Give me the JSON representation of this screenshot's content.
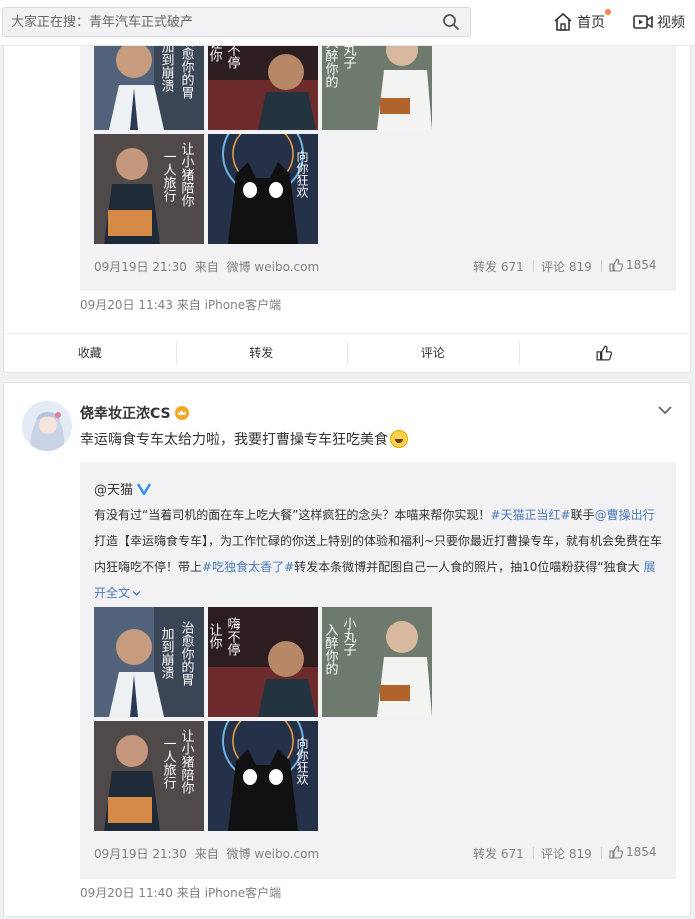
{
  "header": {
    "search_placeholder": "大家正在搜：青年汽车正式破产",
    "nav": [
      {
        "label": "首页",
        "icon": "home-icon"
      },
      {
        "label": "视频",
        "icon": "video-icon"
      }
    ]
  },
  "post1": {
    "repost_meta": {
      "time": "09月19日 21:30",
      "from": "来自",
      "source": "微博 weibo.com"
    },
    "stats": {
      "forward": "转发 671",
      "comment": "评论 819",
      "like": "1854"
    },
    "post_meta": {
      "time": "09月20日 11:43",
      "from": "来自",
      "source": "iPhone客户端"
    },
    "actions": [
      "收藏",
      "转发",
      "评论"
    ]
  },
  "post2": {
    "username": "侥幸妆正浓CS",
    "text": "幸运嗨食专车太给力啦，我要打曹操专车狂吃美食",
    "repost": {
      "author": "@天猫",
      "text_parts": {
        "p1": "有没有过“当着司机的面在车上吃大餐”这样疯狂的念头？本喵来帮你实现！",
        "tag1": "#天猫正当红#",
        "p2": "联手",
        "mention": "@曹操出行",
        "p3": " 打造【幸运嗨食专车】，为工作忙碌的你送上特别的体验和福利~只要你最近打曹操专车，就有机会免费在车内狂嗨吃不停！带上",
        "tag2": "#吃独食太香了#",
        "p4": "转发本条微博并配图自己一人食的照片，抽10位喵粉获得“独食大",
        "expand": "展开全文"
      },
      "meta": {
        "time": "09月19日 21:30",
        "from": "来自",
        "source": "微博 weibo.com"
      },
      "stats": {
        "forward": "转发 671",
        "comment": "评论 819",
        "like": "1854"
      }
    },
    "post_meta": {
      "time": "09月20日 11:40",
      "from": "来自",
      "source": "iPhone客户端"
    }
  },
  "colors": {
    "accent": "#eb7350",
    "link": "#4a7bb8",
    "verified": "#2f8ff7"
  }
}
